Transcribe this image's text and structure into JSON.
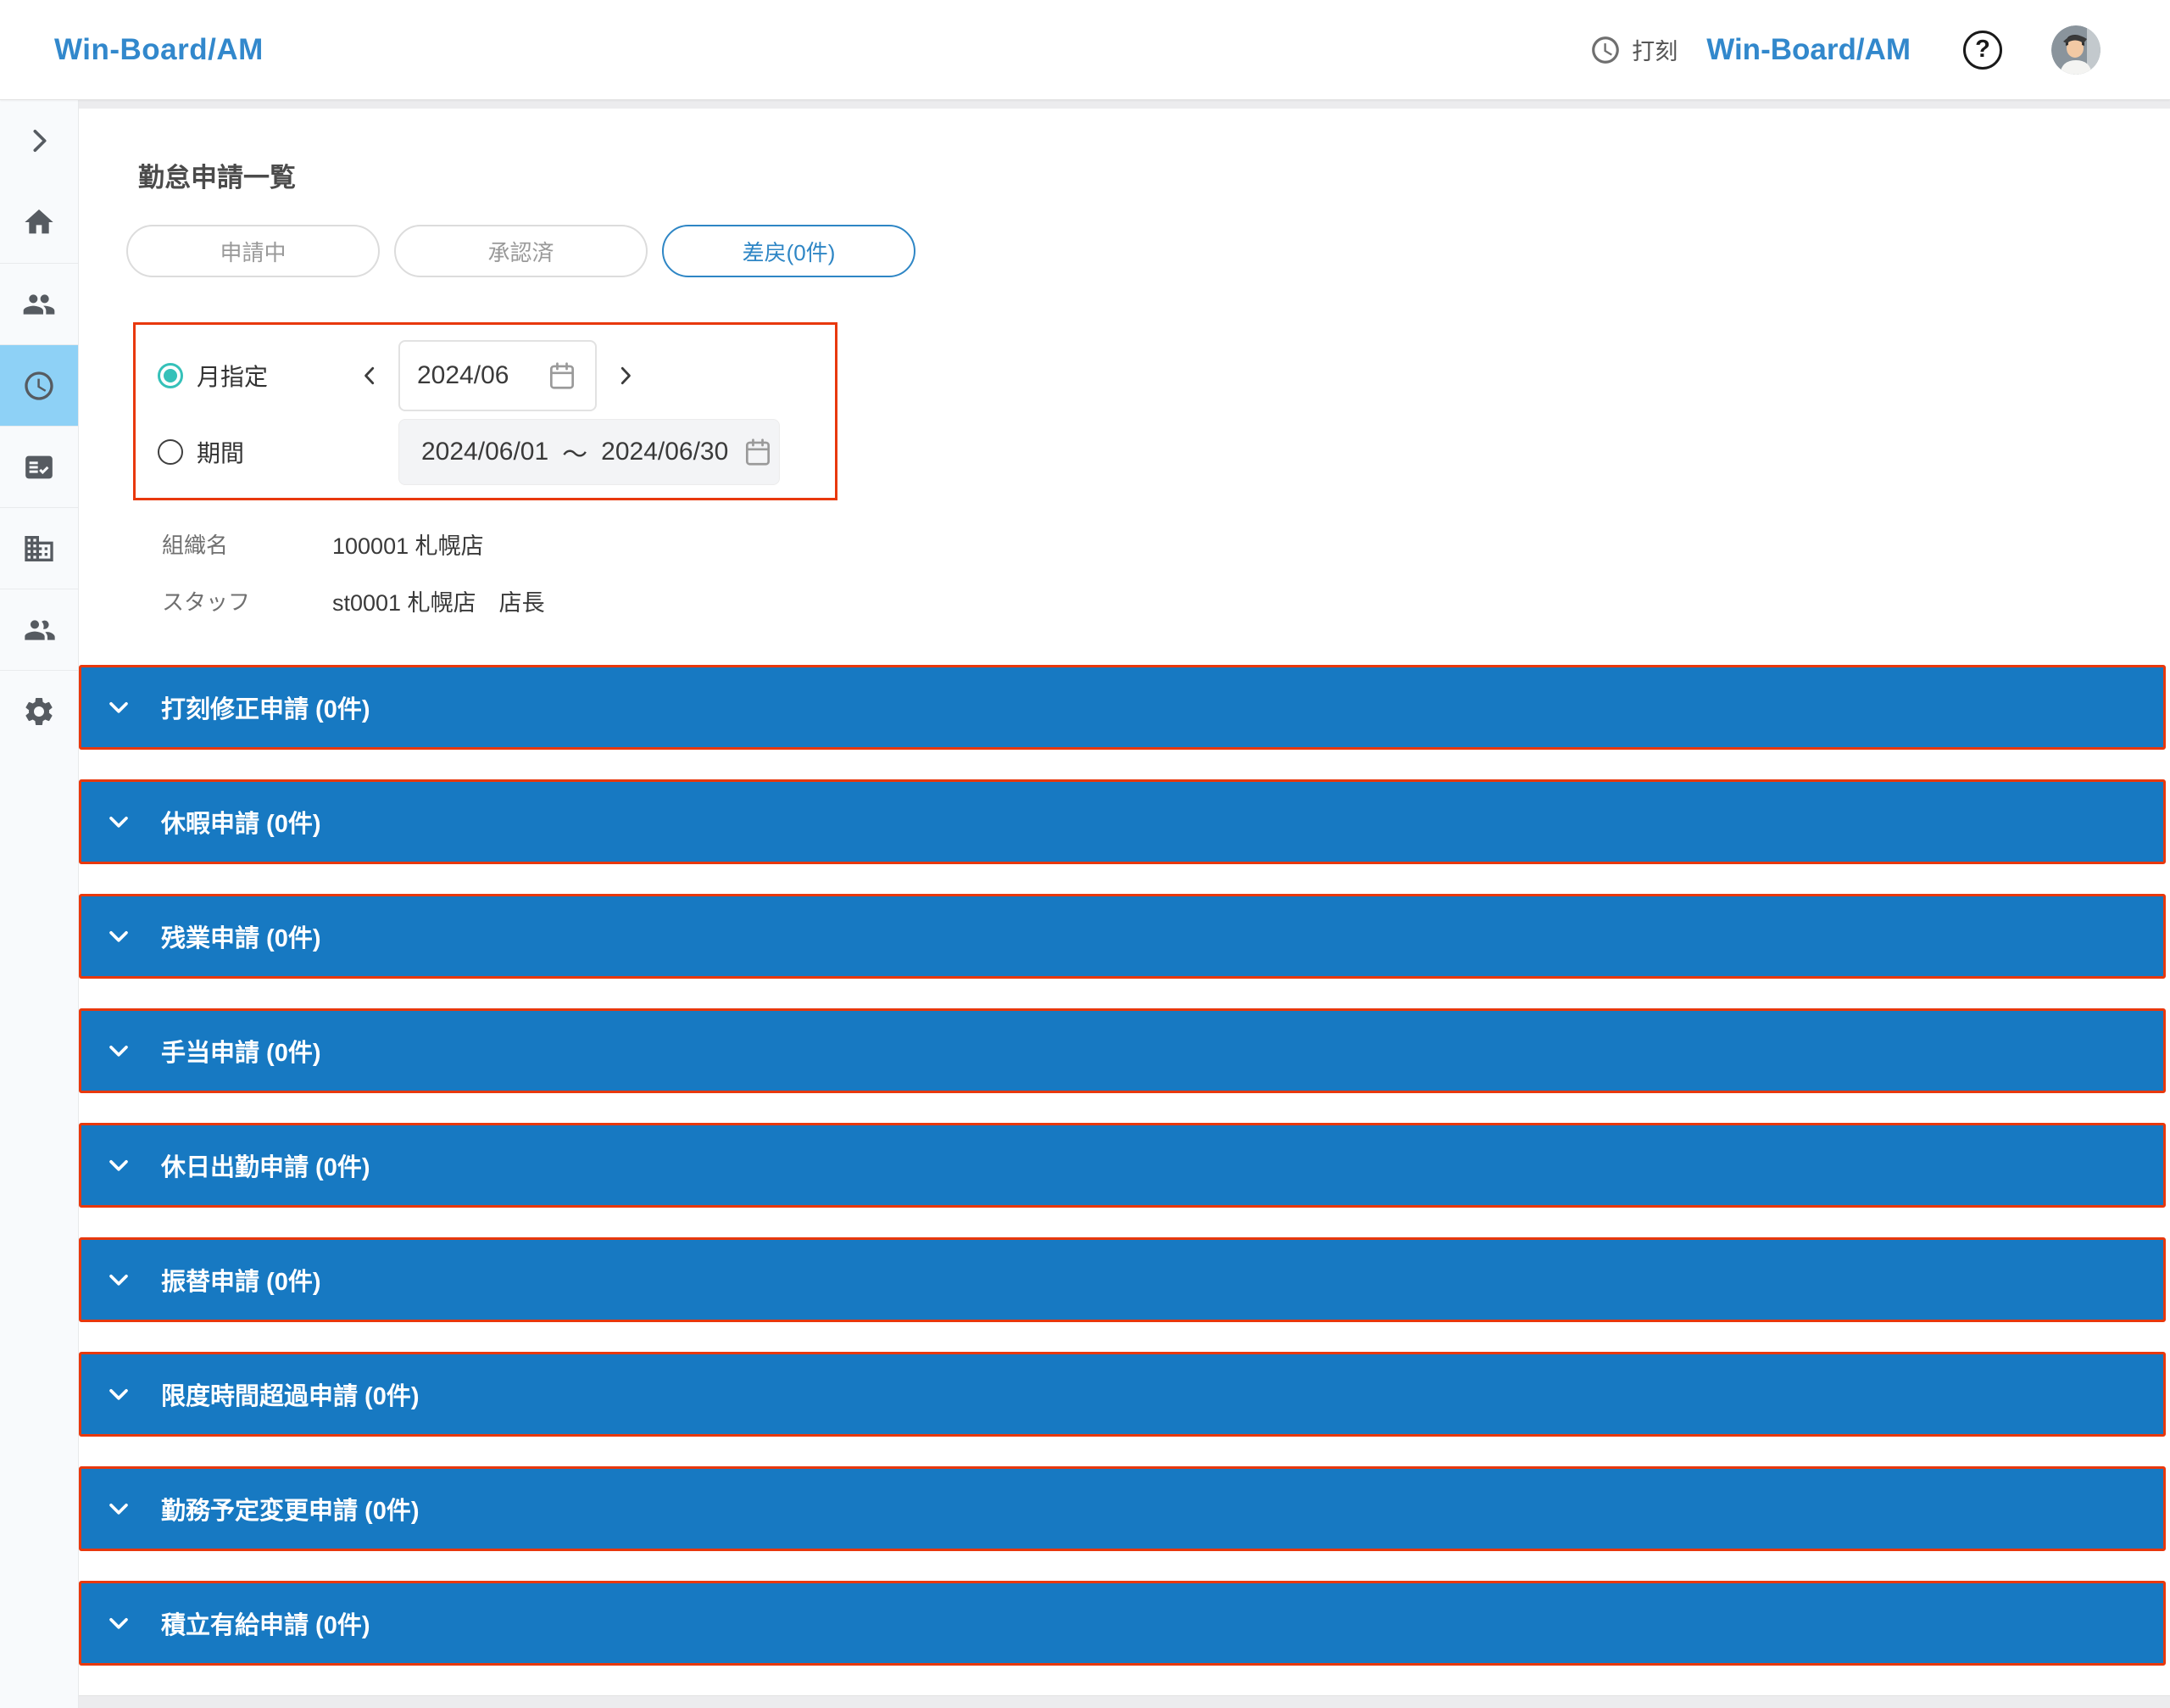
{
  "header": {
    "logo": "Win-Board/AM",
    "punch_label": "打刻",
    "brand": "Win-Board/AM",
    "help_glyph": "?"
  },
  "sidebar": {
    "items": [
      {
        "name": "sidebar-collapse-toggle",
        "icon": "chevron-right-icon",
        "active": false
      },
      {
        "name": "sidebar-item-home",
        "icon": "home-icon",
        "active": false
      },
      {
        "name": "sidebar-item-staff",
        "icon": "people-icon",
        "active": false
      },
      {
        "name": "sidebar-item-attendance",
        "icon": "clock-icon",
        "active": true
      },
      {
        "name": "sidebar-item-requests",
        "icon": "fact-check-icon",
        "active": false
      },
      {
        "name": "sidebar-item-organization",
        "icon": "building-icon",
        "active": false
      },
      {
        "name": "sidebar-item-members",
        "icon": "people-2-icon",
        "active": false
      },
      {
        "name": "sidebar-item-settings",
        "icon": "gear-icon",
        "active": false
      }
    ]
  },
  "page": {
    "title": "勤怠申請一覧",
    "tabs": [
      {
        "name": "tab-pending",
        "label": "申請中",
        "active": false
      },
      {
        "name": "tab-approved",
        "label": "承認済",
        "active": false
      },
      {
        "name": "tab-returned",
        "label": "差戻(0件)",
        "active": true
      }
    ],
    "filter": {
      "month_radio_label": "月指定",
      "month_value": "2024/06",
      "period_radio_label": "期間",
      "period_start": "2024/06/01",
      "period_separator": "～",
      "period_end": "2024/06/30"
    },
    "info": {
      "org_label": "組織名",
      "org_value": "100001 札幌店",
      "staff_label": "スタッフ",
      "staff_value": "st0001 札幌店　店長"
    },
    "accordions": [
      {
        "key": "punch-correction",
        "label": "打刻修正申請 (0件)"
      },
      {
        "key": "leave",
        "label": "休暇申請 (0件)"
      },
      {
        "key": "overtime",
        "label": "残業申請 (0件)"
      },
      {
        "key": "allowance",
        "label": "手当申請 (0件)"
      },
      {
        "key": "holiday-work",
        "label": "休日出勤申請 (0件)"
      },
      {
        "key": "substitute",
        "label": "振替申請 (0件)"
      },
      {
        "key": "limit-exceed",
        "label": "限度時間超過申請 (0件)"
      },
      {
        "key": "schedule-change",
        "label": "勤務予定変更申請 (0件)"
      },
      {
        "key": "accumulated-paid-leave",
        "label": "積立有給申請 (0件)"
      }
    ]
  },
  "colors": {
    "accordion_blue": "#1779c2",
    "highlight_red": "#e8380d",
    "brand_blue": "#3288cc",
    "active_tab_blue": "#2e86c5",
    "radio_teal": "#35c1b9",
    "sidebar_active_bg": "#8ed1f6"
  }
}
